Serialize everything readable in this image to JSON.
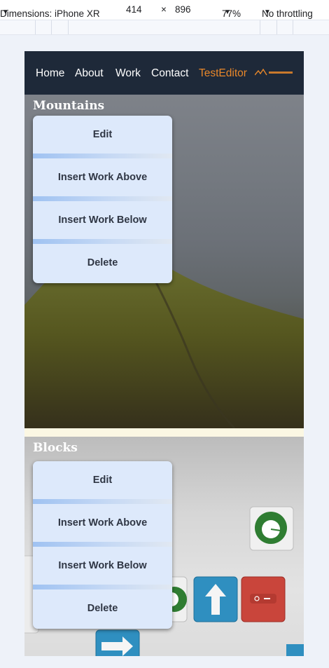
{
  "devtools": {
    "device_label": "Dimensions: iPhone XR",
    "width": "414",
    "times": "×",
    "height": "896",
    "zoom": "77%",
    "throttling": "No throttling"
  },
  "nav": {
    "links": [
      "Home",
      "About",
      "Work",
      "Contact",
      "TestEditor"
    ],
    "active": "TestEditor",
    "active_color": "#e8872a",
    "logo_icon": "mountain-logo-icon"
  },
  "works": [
    {
      "title": "Mountains",
      "menu": [
        "Edit",
        "Insert Work Above",
        "Insert Work Below",
        "Delete"
      ]
    },
    {
      "title": "Blocks",
      "menu": [
        "Edit",
        "Insert Work Above",
        "Insert Work Below",
        "Delete"
      ]
    }
  ],
  "colors": {
    "navbar": "#1e2939",
    "menu_bg": "#dde9fb",
    "menu_separator": "#9fc2f2"
  }
}
